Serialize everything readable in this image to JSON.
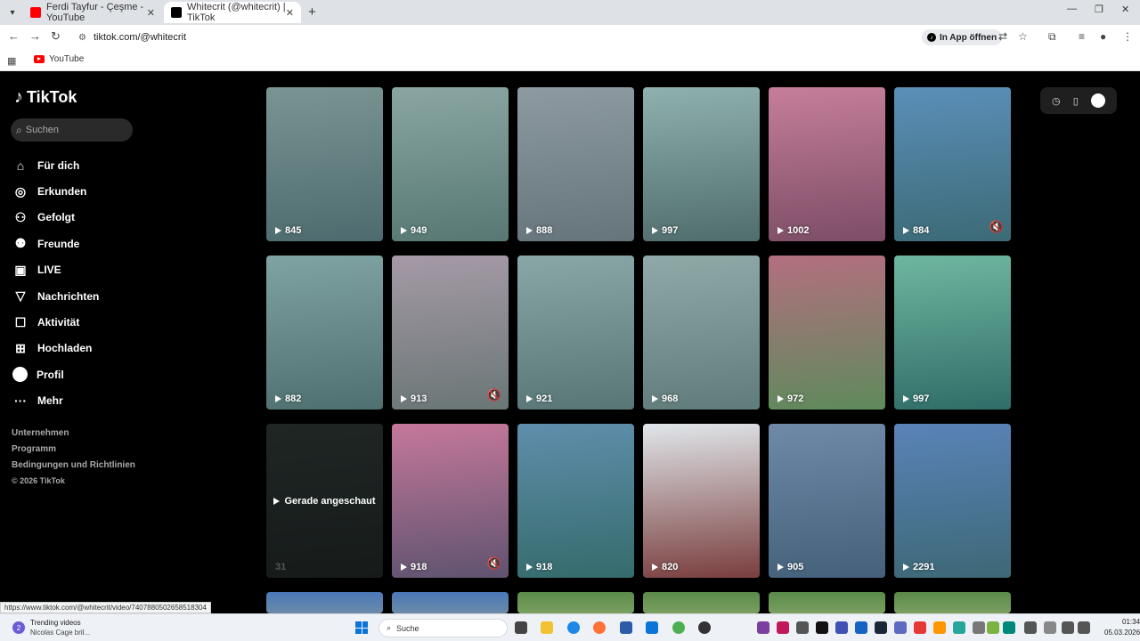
{
  "browser": {
    "tabs": [
      {
        "title": "Ferdi Tayfur - Çeşme - YouTube",
        "active": false
      },
      {
        "title": "Whitecrit (@whitecrit) | TikTok",
        "active": true
      }
    ],
    "address": "tiktok.com/@whitecrit",
    "open_in_app": "In App öffnen",
    "bookmark_youtube": "YouTube",
    "status_url": "https://www.tiktok.com/@whitecrit/video/7407880502658518304"
  },
  "tiktok": {
    "logo_text": "TikTok",
    "search_placeholder": "Suchen",
    "nav": [
      {
        "label": "Für dich",
        "icon": "home-icon"
      },
      {
        "label": "Erkunden",
        "icon": "compass-icon"
      },
      {
        "label": "Gefolgt",
        "icon": "following-icon"
      },
      {
        "label": "Freunde",
        "icon": "friends-icon"
      },
      {
        "label": "LIVE",
        "icon": "live-icon"
      },
      {
        "label": "Nachrichten",
        "icon": "messages-icon"
      },
      {
        "label": "Aktivität",
        "icon": "activity-icon"
      },
      {
        "label": "Hochladen",
        "icon": "upload-icon"
      },
      {
        "label": "Profil",
        "icon": "profile-avatar-icon"
      },
      {
        "label": "Mehr",
        "icon": "more-icon"
      }
    ],
    "footer": {
      "company": "Unternehmen",
      "program": "Programm",
      "terms": "Bedingungen und Richtlinien",
      "copyright": "© 2026 TikTok"
    },
    "videos": [
      {
        "views": "845",
        "muted": false
      },
      {
        "views": "949",
        "muted": false
      },
      {
        "views": "888",
        "muted": false
      },
      {
        "views": "997",
        "muted": false
      },
      {
        "views": "1002",
        "muted": false
      },
      {
        "views": "884",
        "muted": true
      },
      {
        "views": "882",
        "muted": false
      },
      {
        "views": "913",
        "muted": true
      },
      {
        "views": "921",
        "muted": false
      },
      {
        "views": "968",
        "muted": false
      },
      {
        "views": "972",
        "muted": false
      },
      {
        "views": "997",
        "muted": false
      },
      {
        "views": "31",
        "muted": false,
        "watched_label": "Gerade angeschaut"
      },
      {
        "views": "918",
        "muted": true
      },
      {
        "views": "918",
        "muted": false
      },
      {
        "views": "820",
        "muted": false
      },
      {
        "views": "905",
        "muted": false
      },
      {
        "views": "2291",
        "muted": false
      }
    ]
  },
  "taskbar": {
    "widget_badge": "2",
    "widget_title": "Trending videos",
    "widget_sub": "Nicolas Cage bril...",
    "search_label": "Suche",
    "time": "01:34",
    "date": "05.03.2026"
  },
  "colors": {
    "tiktok_bg": "#000000",
    "youtube_red": "#ff0000",
    "windows_blue": "#0a74d9"
  }
}
